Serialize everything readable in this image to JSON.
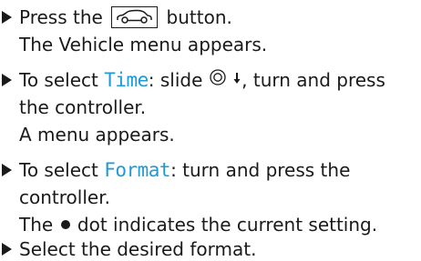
{
  "steps": [
    {
      "lines": [
        {
          "before": "Press the ",
          "icon": "vehicle-key-icon",
          "after": " button."
        },
        {
          "text": "The Vehicle menu appears."
        }
      ]
    },
    {
      "lines": [
        {
          "before": "To select ",
          "highlight": "Time",
          "middle": ": slide ",
          "icon": "controller-icon",
          "after": ", turn and press"
        },
        {
          "text": "the controller."
        },
        {
          "text": "A menu appears."
        }
      ]
    },
    {
      "lines": [
        {
          "before": "To select ",
          "highlight": "Format",
          "after": ": turn and press the"
        },
        {
          "text": "controller."
        },
        {
          "before": "The ",
          "icon": "dot-icon",
          "after": " dot indicates the current setting."
        }
      ]
    },
    {
      "lines": [
        {
          "text": "Select the desired format."
        }
      ]
    }
  ],
  "colors": {
    "text": "#1a1a1a",
    "highlight": "#1e9ad6"
  }
}
